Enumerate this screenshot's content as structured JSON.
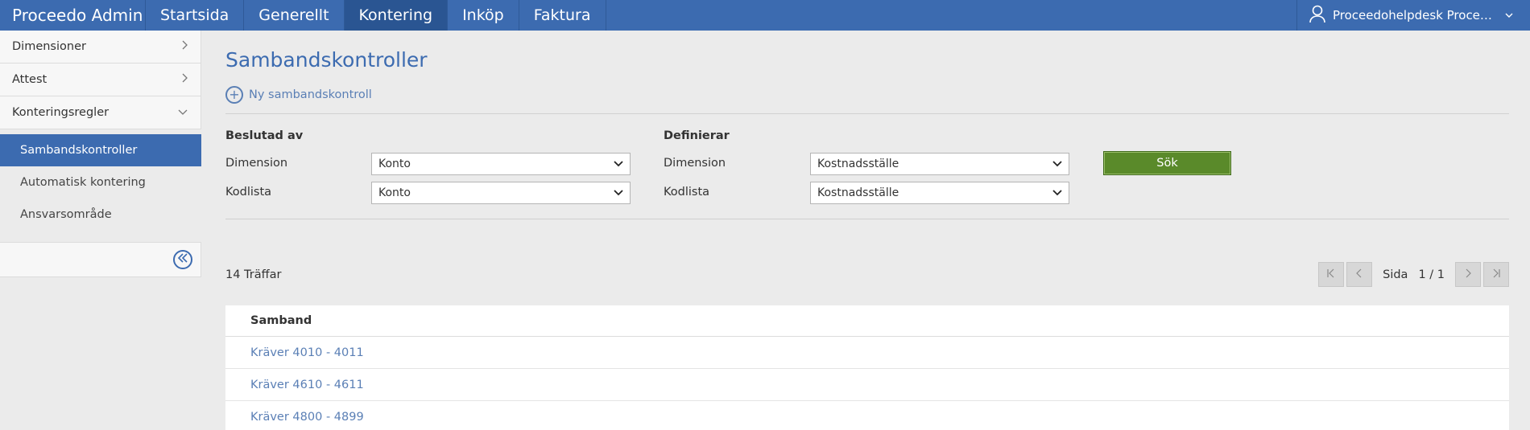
{
  "app": {
    "title": "Proceedo Admin"
  },
  "nav": {
    "tabs": [
      {
        "label": "Startsida"
      },
      {
        "label": "Generellt"
      },
      {
        "label": "Kontering"
      },
      {
        "label": "Inköp"
      },
      {
        "label": "Faktura"
      }
    ],
    "active": "Kontering",
    "user": "Proceedohelpdesk Proceedohelpdesk"
  },
  "sidebar": {
    "items": [
      {
        "label": "Dimensioner"
      },
      {
        "label": "Attest"
      },
      {
        "label": "Konteringsregler"
      }
    ],
    "subitems": [
      {
        "label": "Sambandskontroller"
      },
      {
        "label": "Automatisk kontering"
      },
      {
        "label": "Ansvarsområde"
      }
    ]
  },
  "main": {
    "title": "Sambandskontroller",
    "new_label": "Ny sambandskontroll",
    "left_group": {
      "title": "Beslutad av",
      "dimension_label": "Dimension",
      "dimension_value": "Konto",
      "kodlista_label": "Kodlista",
      "kodlista_value": "Konto"
    },
    "right_group": {
      "title": "Definierar",
      "dimension_label": "Dimension",
      "dimension_value": "Kostnadsställe",
      "kodlista_label": "Kodlista",
      "kodlista_value": "Kostnadsställe"
    },
    "search_label": "Sök",
    "hits": "14 Träffar",
    "pager": {
      "page_label": "Sida",
      "page_value": "1 / 1"
    },
    "table": {
      "header": "Samband",
      "rows": [
        "Kräver 4010 - 4011",
        "Kräver 4610 - 4611",
        "Kräver 4800 - 4899"
      ]
    }
  },
  "colors": {
    "primary": "#3c6bb0",
    "search_button": "#5a8a2a",
    "link": "#5a7fb5"
  }
}
